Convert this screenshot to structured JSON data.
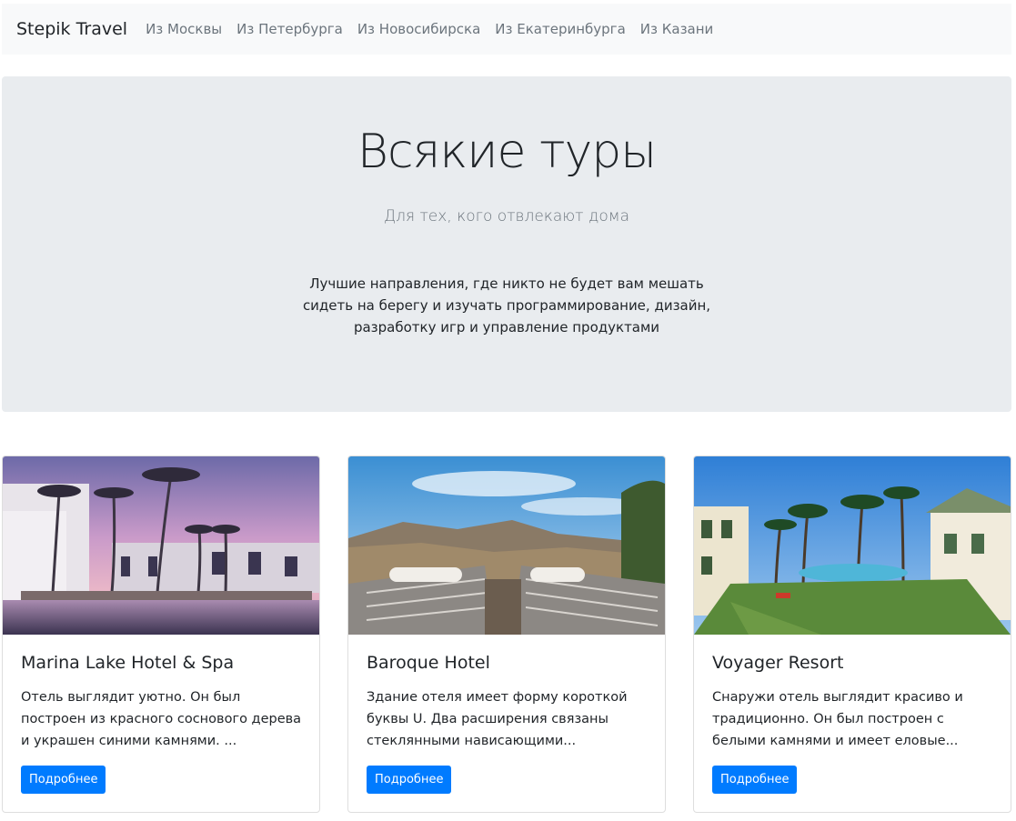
{
  "navbar": {
    "brand": "Stepik Travel",
    "links": [
      "Из Москвы",
      "Из Петербурга",
      "Из Новосибирска",
      "Из Екатеринбурга",
      "Из Казани"
    ]
  },
  "hero": {
    "title": "Всякие туры",
    "subtitle": "Для тех, кого отвлекают дома",
    "description": "Лучшие направления, где никто не будет вам мешать сидеть на берегу и изучать программирование, дизайн, разработку игр и управление продуктами"
  },
  "cards": [
    {
      "title": "Marina Lake Hotel & Spa",
      "text": "Отель выглядит уютно. Он был построен из красного соснового дерева и украшен синими камнями. ...",
      "button": "Подробнее"
    },
    {
      "title": "Baroque Hotel",
      "text": "Здание отеля имеет форму короткой буквы U. Два расширения связаны стеклянными нависающими...",
      "button": "Подробнее"
    },
    {
      "title": "Voyager Resort",
      "text": "Снаружи отель выглядит красиво и традиционно. Он был построен с белыми камнями и имеет еловые...",
      "button": "Подробнее"
    }
  ],
  "colors": {
    "navbar_bg": "#f8f9fa",
    "jumbotron_bg": "#e9ecef",
    "primary": "#007bff"
  }
}
